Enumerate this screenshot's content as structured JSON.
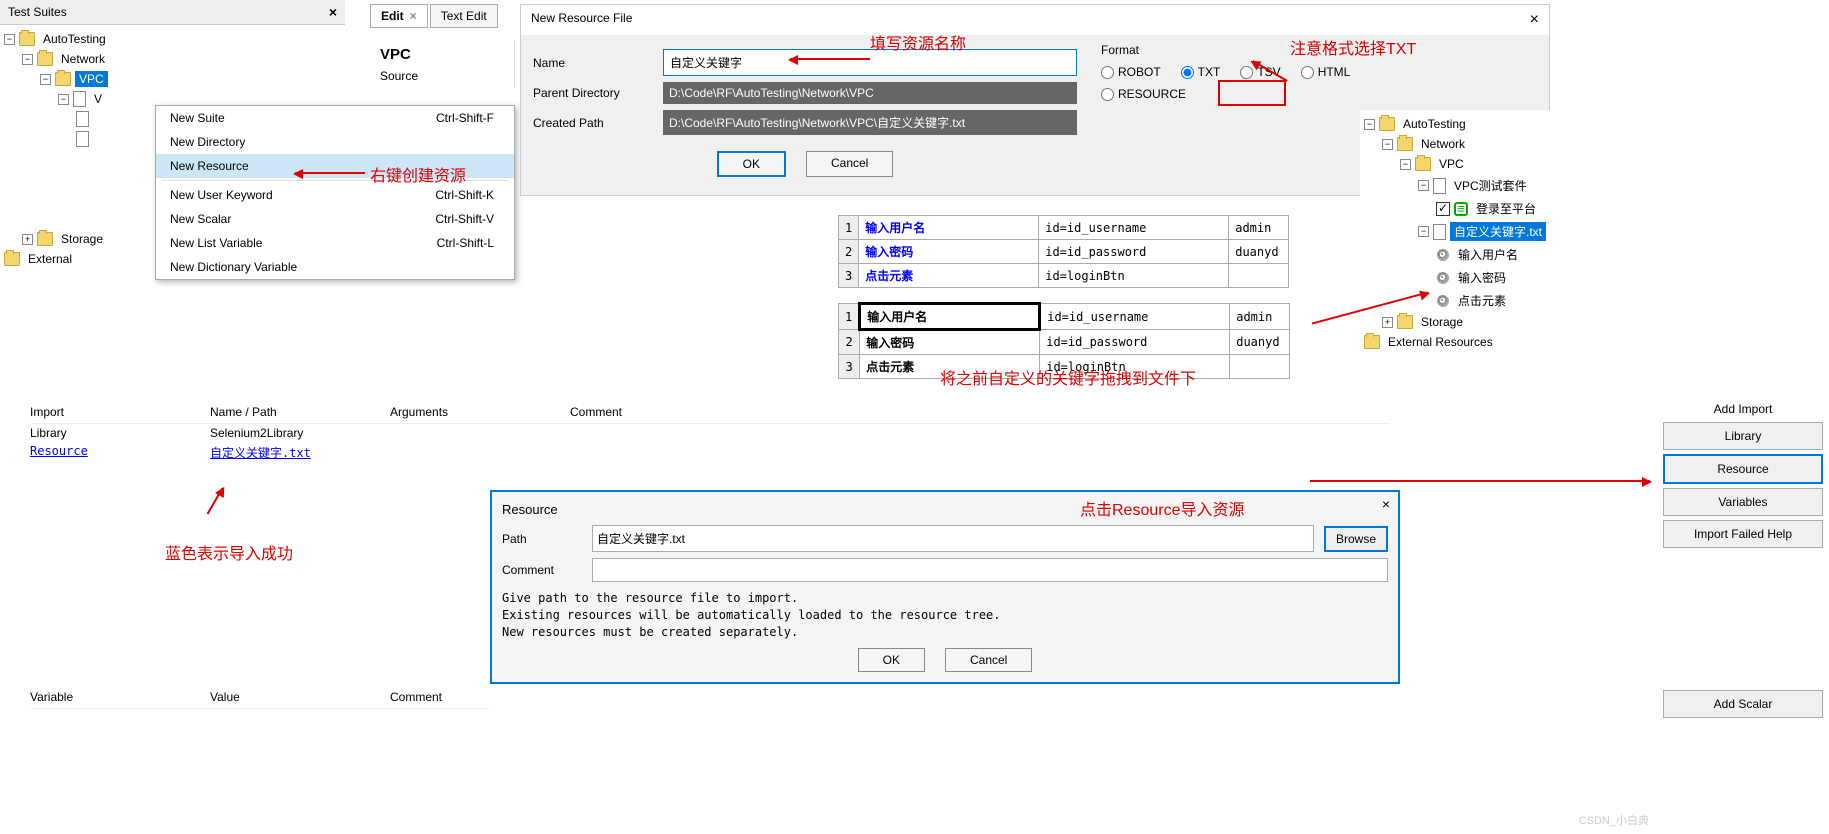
{
  "left_tree": {
    "title": "Test Suites",
    "nodes": {
      "root": "AutoTesting",
      "network": "Network",
      "vpc": "VPC",
      "v": "V",
      "storage": "Storage",
      "external": "External"
    }
  },
  "ctx_menu": {
    "items": [
      {
        "label": "New Suite",
        "accel": "Ctrl-Shift-F"
      },
      {
        "label": "New Directory",
        "accel": ""
      },
      {
        "label": "New Resource",
        "accel": ""
      },
      {
        "label": "New User Keyword",
        "accel": "Ctrl-Shift-K"
      },
      {
        "label": "New Scalar",
        "accel": "Ctrl-Shift-V"
      },
      {
        "label": "New List Variable",
        "accel": "Ctrl-Shift-L"
      },
      {
        "label": "New Dictionary Variable",
        "accel": ""
      }
    ]
  },
  "tabs": {
    "edit": "Edit",
    "text": "Text Edit"
  },
  "side": {
    "vpc": "VPC",
    "source": "Source"
  },
  "new_resource": {
    "title": "New Resource File",
    "labels": {
      "name": "Name",
      "parent": "Parent Directory",
      "created": "Created Path",
      "format": "Format"
    },
    "name_value": "自定义关键字",
    "parent_value": "D:\\Code\\RF\\AutoTesting\\Network\\VPC",
    "created_value": "D:\\Code\\RF\\AutoTesting\\Network\\VPC\\自定义关键字.txt",
    "formats": {
      "robot": "ROBOT",
      "txt": "TXT",
      "tsv": "TSV",
      "html": "HTML",
      "resource": "RESOURCE"
    },
    "ok": "OK",
    "cancel": "Cancel"
  },
  "grid1": [
    {
      "n": "1",
      "kw": "输入用户名",
      "a": "id=id_username",
      "v": "admin"
    },
    {
      "n": "2",
      "kw": "输入密码",
      "a": "id=id_password",
      "v": "duanyd"
    },
    {
      "n": "3",
      "kw": "点击元素",
      "a": "id=loginBtn",
      "v": ""
    }
  ],
  "grid2": [
    {
      "n": "1",
      "kw": "输入用户名",
      "a": "id=id_username",
      "v": "admin"
    },
    {
      "n": "2",
      "kw": "输入密码",
      "a": "id=id_password",
      "v": "duanyd"
    },
    {
      "n": "3",
      "kw": "点击元素",
      "a": "id=loginBtn",
      "v": ""
    }
  ],
  "right_tree": {
    "root": "AutoTesting",
    "network": "Network",
    "vpc": "VPC",
    "suite": "VPC测试套件",
    "login": "登录至平台",
    "file": "自定义关键字.txt",
    "kw1": "输入用户名",
    "kw2": "输入密码",
    "kw3": "点击元素",
    "storage": "Storage",
    "external": "External Resources"
  },
  "import_area": {
    "headers": {
      "import": "Import",
      "name": "Name / Path",
      "args": "Arguments",
      "comment": "Comment"
    },
    "rows": [
      {
        "type": "Library",
        "name": "Selenium2Library"
      },
      {
        "type": "Resource",
        "name": "自定义关键字.txt",
        "link": true
      }
    ],
    "var_headers": {
      "variable": "Variable",
      "value": "Value",
      "comment": "Comment"
    }
  },
  "btn_stack": {
    "title": "Add Import",
    "library": "Library",
    "resource": "Resource",
    "variables": "Variables",
    "help": "Import Failed Help",
    "scalar": "Add Scalar"
  },
  "res_dlg": {
    "title": "Resource",
    "path_label": "Path",
    "path_value": "自定义关键字.txt",
    "comment_label": "Comment",
    "browse": "Browse",
    "hint": "Give path to the resource file to import.\nExisting resources will be automatically loaded to the resource tree.\nNew resources must be created separately.",
    "ok": "OK",
    "cancel": "Cancel"
  },
  "annotations": {
    "a1": "填写资源名称",
    "a2": "注意格式选择TXT",
    "a3": "右键创建资源",
    "a4": "将之前自定义的关键字拖拽到文件下",
    "a5": "点击Resource导入资源",
    "a6": "蓝色表示导入成功"
  },
  "watermark": "CSDN_小白典"
}
